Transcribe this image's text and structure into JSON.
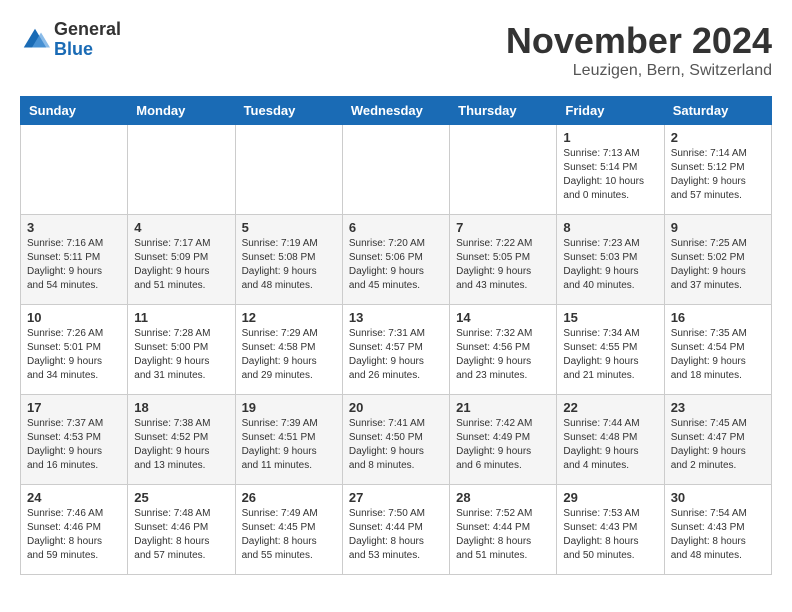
{
  "logo": {
    "general": "General",
    "blue": "Blue"
  },
  "title": "November 2024",
  "location": "Leuzigen, Bern, Switzerland",
  "days_of_week": [
    "Sunday",
    "Monday",
    "Tuesday",
    "Wednesday",
    "Thursday",
    "Friday",
    "Saturday"
  ],
  "weeks": [
    [
      {
        "day": "",
        "info": ""
      },
      {
        "day": "",
        "info": ""
      },
      {
        "day": "",
        "info": ""
      },
      {
        "day": "",
        "info": ""
      },
      {
        "day": "",
        "info": ""
      },
      {
        "day": "1",
        "info": "Sunrise: 7:13 AM\nSunset: 5:14 PM\nDaylight: 10 hours and 0 minutes."
      },
      {
        "day": "2",
        "info": "Sunrise: 7:14 AM\nSunset: 5:12 PM\nDaylight: 9 hours and 57 minutes."
      }
    ],
    [
      {
        "day": "3",
        "info": "Sunrise: 7:16 AM\nSunset: 5:11 PM\nDaylight: 9 hours and 54 minutes."
      },
      {
        "day": "4",
        "info": "Sunrise: 7:17 AM\nSunset: 5:09 PM\nDaylight: 9 hours and 51 minutes."
      },
      {
        "day": "5",
        "info": "Sunrise: 7:19 AM\nSunset: 5:08 PM\nDaylight: 9 hours and 48 minutes."
      },
      {
        "day": "6",
        "info": "Sunrise: 7:20 AM\nSunset: 5:06 PM\nDaylight: 9 hours and 45 minutes."
      },
      {
        "day": "7",
        "info": "Sunrise: 7:22 AM\nSunset: 5:05 PM\nDaylight: 9 hours and 43 minutes."
      },
      {
        "day": "8",
        "info": "Sunrise: 7:23 AM\nSunset: 5:03 PM\nDaylight: 9 hours and 40 minutes."
      },
      {
        "day": "9",
        "info": "Sunrise: 7:25 AM\nSunset: 5:02 PM\nDaylight: 9 hours and 37 minutes."
      }
    ],
    [
      {
        "day": "10",
        "info": "Sunrise: 7:26 AM\nSunset: 5:01 PM\nDaylight: 9 hours and 34 minutes."
      },
      {
        "day": "11",
        "info": "Sunrise: 7:28 AM\nSunset: 5:00 PM\nDaylight: 9 hours and 31 minutes."
      },
      {
        "day": "12",
        "info": "Sunrise: 7:29 AM\nSunset: 4:58 PM\nDaylight: 9 hours and 29 minutes."
      },
      {
        "day": "13",
        "info": "Sunrise: 7:31 AM\nSunset: 4:57 PM\nDaylight: 9 hours and 26 minutes."
      },
      {
        "day": "14",
        "info": "Sunrise: 7:32 AM\nSunset: 4:56 PM\nDaylight: 9 hours and 23 minutes."
      },
      {
        "day": "15",
        "info": "Sunrise: 7:34 AM\nSunset: 4:55 PM\nDaylight: 9 hours and 21 minutes."
      },
      {
        "day": "16",
        "info": "Sunrise: 7:35 AM\nSunset: 4:54 PM\nDaylight: 9 hours and 18 minutes."
      }
    ],
    [
      {
        "day": "17",
        "info": "Sunrise: 7:37 AM\nSunset: 4:53 PM\nDaylight: 9 hours and 16 minutes."
      },
      {
        "day": "18",
        "info": "Sunrise: 7:38 AM\nSunset: 4:52 PM\nDaylight: 9 hours and 13 minutes."
      },
      {
        "day": "19",
        "info": "Sunrise: 7:39 AM\nSunset: 4:51 PM\nDaylight: 9 hours and 11 minutes."
      },
      {
        "day": "20",
        "info": "Sunrise: 7:41 AM\nSunset: 4:50 PM\nDaylight: 9 hours and 8 minutes."
      },
      {
        "day": "21",
        "info": "Sunrise: 7:42 AM\nSunset: 4:49 PM\nDaylight: 9 hours and 6 minutes."
      },
      {
        "day": "22",
        "info": "Sunrise: 7:44 AM\nSunset: 4:48 PM\nDaylight: 9 hours and 4 minutes."
      },
      {
        "day": "23",
        "info": "Sunrise: 7:45 AM\nSunset: 4:47 PM\nDaylight: 9 hours and 2 minutes."
      }
    ],
    [
      {
        "day": "24",
        "info": "Sunrise: 7:46 AM\nSunset: 4:46 PM\nDaylight: 8 hours and 59 minutes."
      },
      {
        "day": "25",
        "info": "Sunrise: 7:48 AM\nSunset: 4:46 PM\nDaylight: 8 hours and 57 minutes."
      },
      {
        "day": "26",
        "info": "Sunrise: 7:49 AM\nSunset: 4:45 PM\nDaylight: 8 hours and 55 minutes."
      },
      {
        "day": "27",
        "info": "Sunrise: 7:50 AM\nSunset: 4:44 PM\nDaylight: 8 hours and 53 minutes."
      },
      {
        "day": "28",
        "info": "Sunrise: 7:52 AM\nSunset: 4:44 PM\nDaylight: 8 hours and 51 minutes."
      },
      {
        "day": "29",
        "info": "Sunrise: 7:53 AM\nSunset: 4:43 PM\nDaylight: 8 hours and 50 minutes."
      },
      {
        "day": "30",
        "info": "Sunrise: 7:54 AM\nSunset: 4:43 PM\nDaylight: 8 hours and 48 minutes."
      }
    ]
  ]
}
